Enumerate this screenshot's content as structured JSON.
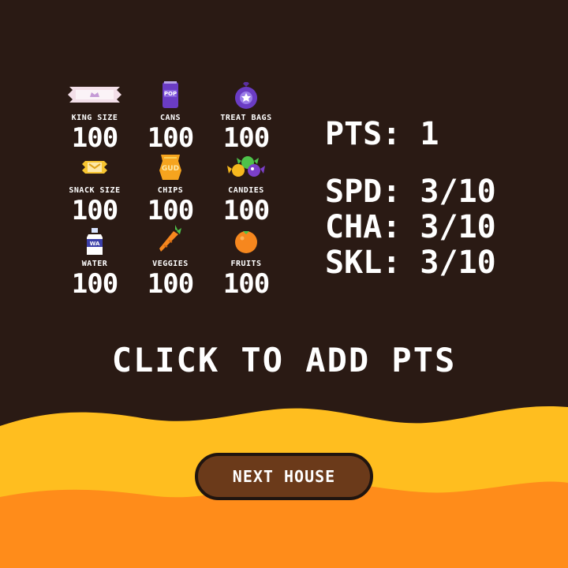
{
  "colors": {
    "background": "#2a1a14",
    "wave_yellow": "#ffbe1f",
    "wave_orange": "#ff8c1a",
    "button_fill": "#6b3a1a",
    "button_border": "#1f140f",
    "text": "#ffffff"
  },
  "treats": [
    {
      "label": "KING SIZE",
      "count": "100",
      "icon": "king-size-candy-bar-icon"
    },
    {
      "label": "CANS",
      "count": "100",
      "icon": "soda-can-icon"
    },
    {
      "label": "TREAT BAGS",
      "count": "100",
      "icon": "treat-bag-icon"
    },
    {
      "label": "SNACK SIZE",
      "count": "100",
      "icon": "snack-size-candy-icon"
    },
    {
      "label": "CHIPS",
      "count": "100",
      "icon": "chips-bag-icon"
    },
    {
      "label": "CANDIES",
      "count": "100",
      "icon": "wrapped-candies-icon"
    },
    {
      "label": "WATER",
      "count": "100",
      "icon": "water-bottle-icon"
    },
    {
      "label": "VEGGIES",
      "count": "100",
      "icon": "carrot-icon"
    },
    {
      "label": "FRUITS",
      "count": "100",
      "icon": "orange-fruit-icon"
    }
  ],
  "stats": {
    "pts": "PTS: 1",
    "spd": "SPD: 3/10",
    "cha": "CHA: 3/10",
    "skl": "SKL: 3/10"
  },
  "prompt": "CLICK TO ADD PTS",
  "next_button_label": "NEXT HOUSE"
}
